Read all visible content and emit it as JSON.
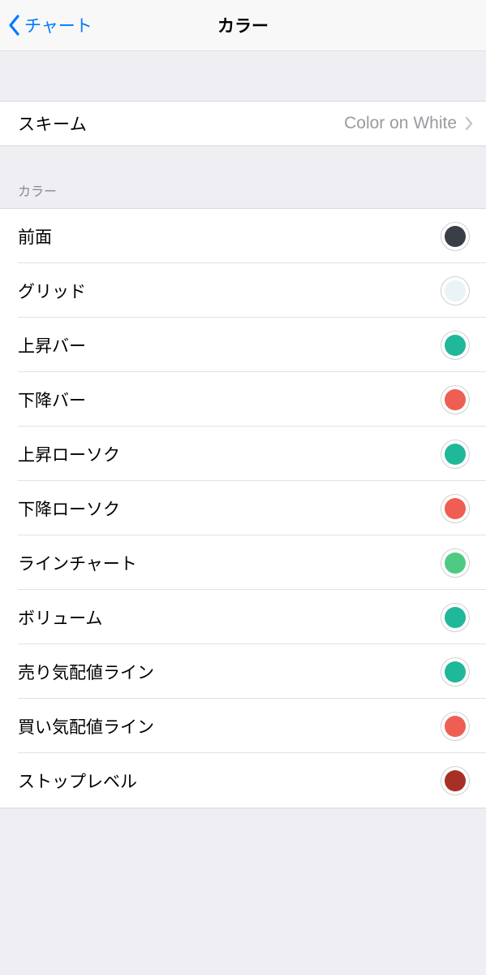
{
  "nav": {
    "back_label": "チャート",
    "title": "カラー"
  },
  "scheme": {
    "label": "スキーム",
    "value": "Color on White"
  },
  "section_header": "カラー",
  "colors": [
    {
      "label": "前面",
      "value": "#3a3e46"
    },
    {
      "label": "グリッド",
      "value": "#eaf3f5"
    },
    {
      "label": "上昇バー",
      "value": "#1fb89a"
    },
    {
      "label": "下降バー",
      "value": "#ef5e53"
    },
    {
      "label": "上昇ローソク",
      "value": "#1fb89a"
    },
    {
      "label": "下降ローソク",
      "value": "#ef5e53"
    },
    {
      "label": "ラインチャート",
      "value": "#4fca83"
    },
    {
      "label": "ボリューム",
      "value": "#1fb89a"
    },
    {
      "label": "売り気配値ライン",
      "value": "#1fb89a"
    },
    {
      "label": "買い気配値ライン",
      "value": "#ef5e53"
    },
    {
      "label": "ストップレベル",
      "value": "#a82f26"
    }
  ]
}
